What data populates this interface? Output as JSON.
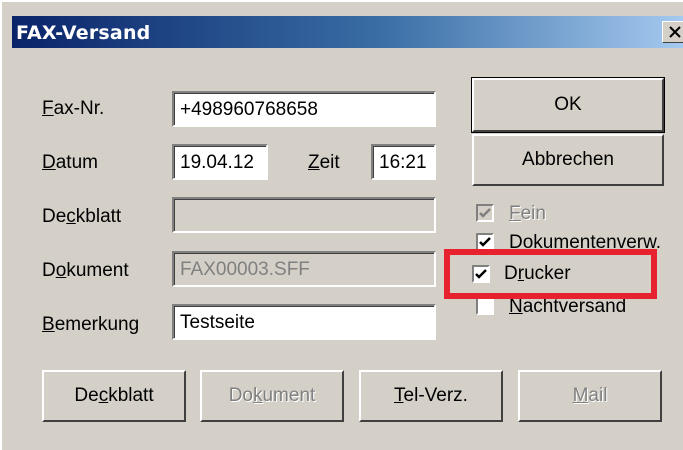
{
  "window": {
    "title": "FAX-Versand",
    "close_glyph": "close-icon"
  },
  "fields": {
    "fax_nr": {
      "label_key": "F",
      "label_rest": "ax-Nr.",
      "value": "+498960768658"
    },
    "datum": {
      "label_key": "D",
      "label_rest": "atum",
      "value": "19.04.12"
    },
    "zeit": {
      "label_key": "Z",
      "label_rest": "eit",
      "value": "16:21"
    },
    "deckblatt": {
      "label_pre": "De",
      "label_key": "c",
      "label_rest": "kblatt",
      "value": ""
    },
    "dokument": {
      "label_pre": "D",
      "label_key": "o",
      "label_rest": "kument",
      "value": "FAX00003.SFF"
    },
    "bemerkung": {
      "label_key": "B",
      "label_rest": "emerkung",
      "value": "Testseite"
    }
  },
  "buttons": {
    "ok": "OK",
    "abbrechen": "Abbrechen",
    "deckblatt": {
      "pre": "De",
      "key": "c",
      "rest": "kblatt"
    },
    "dokument": {
      "pre": "Do",
      "key": "k",
      "rest": "ument"
    },
    "tel_verz": {
      "pre": "",
      "key": "T",
      "rest": "el-Verz."
    },
    "mail": {
      "pre": "",
      "key": "M",
      "rest": "ail"
    }
  },
  "checkboxes": [
    {
      "label_pre": "",
      "label_key": "F",
      "label_rest": "ein",
      "checked": true,
      "enabled": false
    },
    {
      "label_pre": "",
      "label_key": "D",
      "label_rest": "okumentenverw.",
      "checked": true,
      "enabled": true
    },
    {
      "label_pre": "D",
      "label_key": "r",
      "label_rest": "ucker",
      "checked": true,
      "enabled": true
    },
    {
      "label_pre": "",
      "label_key": "N",
      "label_rest": "achtversand",
      "checked": false,
      "enabled": true
    }
  ],
  "colors": {
    "highlight": "#e8212e",
    "titlebar_start": "#0a246a",
    "dialog_bg": "#d4d0c8"
  }
}
